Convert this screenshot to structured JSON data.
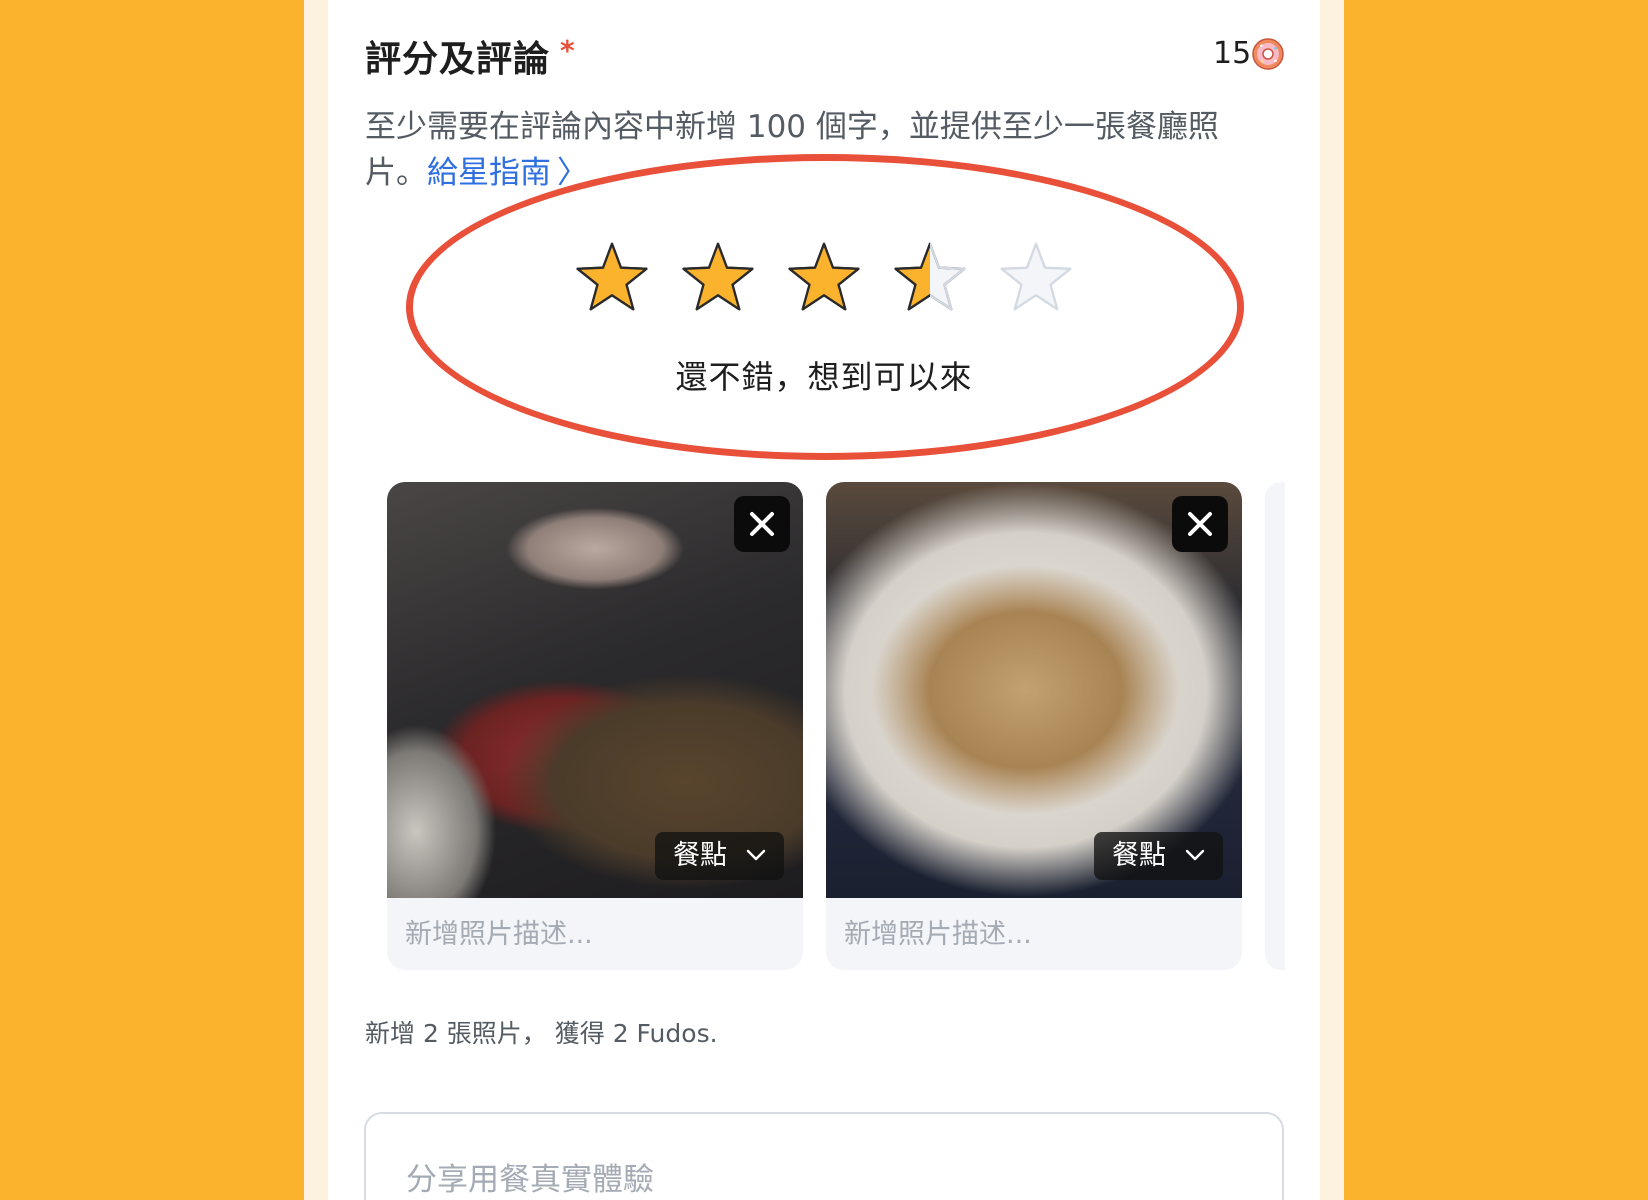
{
  "rating_section": {
    "title": "評分及評論",
    "required_marker": "*",
    "points": "15",
    "points_icon": "donut-icon",
    "description": "至少需要在評論內容中新增 100 個字，並提供至少一張餐廳照片。",
    "guide_link": "給星指南"
  },
  "rating": {
    "value": 3.5,
    "max": 5,
    "label": "還不錯，想到可以來",
    "highlight_color": "#E8503A",
    "star_fill": "#FBB22D",
    "star_empty": "#F3F5F9"
  },
  "photos": [
    {
      "category": "餐點",
      "caption_placeholder": "新增照片描述..."
    },
    {
      "category": "餐點",
      "caption_placeholder": "新增照片描述..."
    }
  ],
  "photos_note": "新增 2 張照片， 獲得 2 Fudos.",
  "review": {
    "placeholder": "分享用餐真實體驗"
  },
  "colors": {
    "background": "#FBB22D",
    "link": "#2F6FE0",
    "accent_red": "#E8503A"
  }
}
